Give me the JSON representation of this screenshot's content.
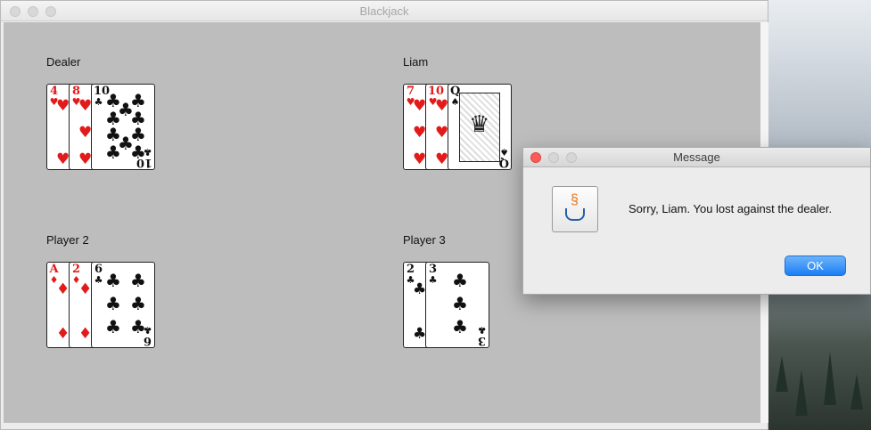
{
  "window": {
    "title": "Blackjack"
  },
  "players": [
    {
      "name": "Dealer",
      "cards": [
        {
          "rank": "4",
          "suit": "♥",
          "color": "red"
        },
        {
          "rank": "8",
          "suit": "♥",
          "color": "red"
        },
        {
          "rank": "10",
          "suit": "♣",
          "color": "black"
        }
      ]
    },
    {
      "name": "Liam",
      "cards": [
        {
          "rank": "7",
          "suit": "♥",
          "color": "red"
        },
        {
          "rank": "10",
          "suit": "♥",
          "color": "red"
        },
        {
          "rank": "Q",
          "suit": "♠",
          "color": "black",
          "face": true
        }
      ]
    },
    {
      "name": "Player 2",
      "cards": [
        {
          "rank": "A",
          "suit": "♦",
          "color": "red"
        },
        {
          "rank": "2",
          "suit": "♦",
          "color": "red"
        },
        {
          "rank": "6",
          "suit": "♣",
          "color": "black"
        }
      ]
    },
    {
      "name": "Player 3",
      "cards": [
        {
          "rank": "2",
          "suit": "♣",
          "color": "black"
        },
        {
          "rank": "3",
          "suit": "♣",
          "color": "black"
        }
      ]
    }
  ],
  "dialog": {
    "title": "Message",
    "message": "Sorry, Liam. You lost against the dealer.",
    "ok_label": "OK",
    "icon": "java-icon"
  },
  "colors": {
    "table": "#bdbdbd",
    "red_suit": "#e21a1a",
    "ok_button": "#1b7ef4"
  }
}
